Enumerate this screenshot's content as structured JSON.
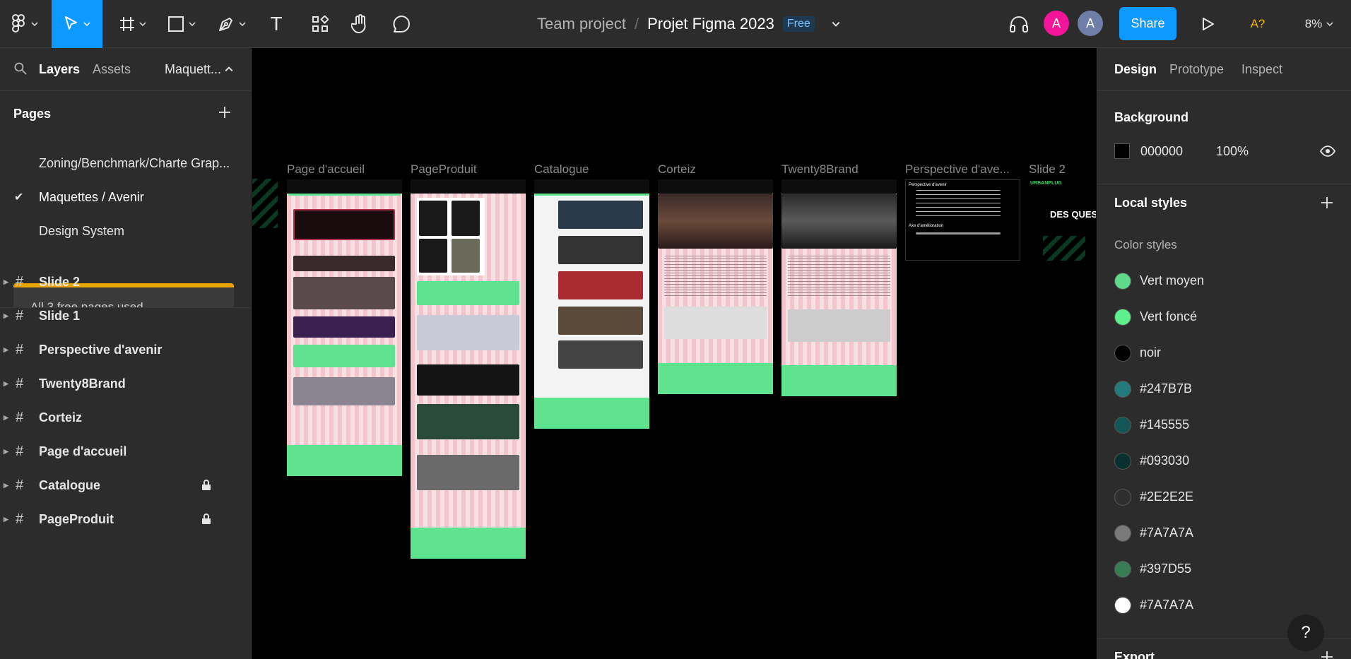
{
  "toolbar": {
    "move_tool": "move-tool",
    "frame_tool": "frame-tool",
    "shape_tool": "rectangle-tool",
    "pen_tool": "pen-tool",
    "text_tool": "T",
    "resources_tool": "resources-tool",
    "hand_tool": "hand-tool",
    "comment_tool": "comment-tool"
  },
  "header": {
    "team": "Team project",
    "separator": "/",
    "project": "Projet Figma 2023",
    "plan_badge": "Free",
    "avatar1": "A",
    "avatar2": "A",
    "share_label": "Share",
    "accessibility_label": "A?",
    "zoom": "8%"
  },
  "left_panel": {
    "tabs": {
      "layers": "Layers",
      "assets": "Assets",
      "current_page": "Maquett..."
    },
    "pages_title": "Pages",
    "pages": [
      {
        "label": "Zoning/Benchmark/Charte Grap...",
        "selected": false
      },
      {
        "label": "Maquettes / Avenir",
        "selected": true
      },
      {
        "label": "Design System",
        "selected": false
      }
    ],
    "free_banner": "All 3 free pages used",
    "layers": [
      {
        "label": "Slide 2",
        "locked": false
      },
      {
        "label": "Slide 1",
        "locked": false
      },
      {
        "label": "Perspective d'avenir",
        "locked": false
      },
      {
        "label": "Twenty8Brand",
        "locked": false
      },
      {
        "label": "Corteiz",
        "locked": false
      },
      {
        "label": "Page d'accueil",
        "locked": false
      },
      {
        "label": "Catalogue",
        "locked": true
      },
      {
        "label": "PageProduit",
        "locked": true
      }
    ]
  },
  "canvas": {
    "frames": [
      {
        "label": "Page d'accueil"
      },
      {
        "label": "PageProduit"
      },
      {
        "label": "Catalogue"
      },
      {
        "label": "Corteiz"
      },
      {
        "label": "Twenty8Brand"
      },
      {
        "label": "Perspective d'ave..."
      },
      {
        "label": "Slide 2"
      }
    ],
    "slide2_text": "DES QUEST",
    "slide2_brand": "URBANPLUG",
    "perspective_title": "Perspective d'avenir",
    "perspective_sub": "Axe d'amélioration"
  },
  "right_panel": {
    "tabs": {
      "design": "Design",
      "prototype": "Prototype",
      "inspect": "Inspect"
    },
    "background_title": "Background",
    "background_hex": "000000",
    "background_opacity": "100%",
    "local_styles_title": "Local styles",
    "color_styles_title": "Color styles",
    "color_styles": [
      {
        "name": "Vert moyen",
        "color": "#5fd98a"
      },
      {
        "name": "Vert foncé",
        "color": "#5ef08d"
      },
      {
        "name": "noir",
        "color": "#000000"
      },
      {
        "name": "#247B7B",
        "color": "#247B7B"
      },
      {
        "name": "#145555",
        "color": "#145555"
      },
      {
        "name": "#093030",
        "color": "#093030"
      },
      {
        "name": "#2E2E2E",
        "color": "#2E2E2E"
      },
      {
        "name": "#7A7A7A",
        "color": "#7A7A7A"
      },
      {
        "name": "#397D55",
        "color": "#397D55"
      },
      {
        "name": "#7A7A7A",
        "color": "#FFFFFF"
      }
    ],
    "export_title": "Export",
    "help": "?"
  }
}
